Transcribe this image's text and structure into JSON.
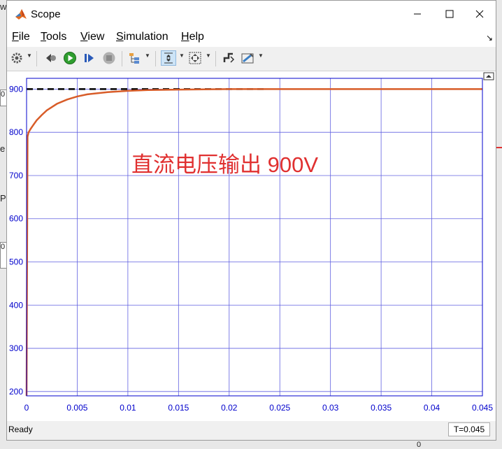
{
  "window": {
    "title": "Scope"
  },
  "menu": [
    {
      "label": "File",
      "key": "F",
      "rest": "ile"
    },
    {
      "label": "Tools",
      "key": "T",
      "rest": "ools"
    },
    {
      "label": "View",
      "key": "V",
      "rest": "iew"
    },
    {
      "label": "Simulation",
      "key": "S",
      "rest": "imulation"
    },
    {
      "label": "Help",
      "key": "H",
      "rest": "elp"
    }
  ],
  "toolbar": [
    "gear-icon",
    "step-back-icon",
    "run-icon",
    "step-forward-icon",
    "stop-icon",
    "signal-tree-icon",
    "zoom-icon",
    "fit-icon",
    "style-icon",
    "measure-icon"
  ],
  "annotation": "直流电压输出 900V",
  "status": {
    "text": "Ready",
    "time": "T=0.045"
  },
  "background_peeks": [
    "w",
    "0",
    "e",
    "PI",
    "0",
    "0"
  ],
  "colors": {
    "axes": "#0000cc",
    "grid": "#6060e0",
    "signal": "#d85c28",
    "reference": "#000000",
    "annotation": "#e03030"
  },
  "chart_data": {
    "type": "line",
    "xlim": [
      0,
      0.045
    ],
    "ylim": [
      190,
      925
    ],
    "xticks": [
      0,
      0.005,
      0.01,
      0.015,
      0.02,
      0.025,
      0.03,
      0.035,
      0.04,
      0.045
    ],
    "xtick_labels": [
      "0",
      "0.005",
      "0.01",
      "0.015",
      "0.02",
      "0.025",
      "0.03",
      "0.035",
      "0.04",
      "0.045"
    ],
    "yticks": [
      200,
      300,
      400,
      500,
      600,
      700,
      800,
      900
    ],
    "ytick_labels": [
      "200",
      "300",
      "400",
      "500",
      "600",
      "700",
      "800",
      "900"
    ],
    "grid": true,
    "series": [
      {
        "style": "dashed",
        "color": "#000000",
        "x": [
          0,
          0.0235
        ],
        "y": [
          900,
          900
        ]
      },
      {
        "style": "solid",
        "color": "#d85c28",
        "x": [
          0,
          0.0001,
          0.0002,
          0.0004,
          0.0007,
          0.001,
          0.0015,
          0.002,
          0.003,
          0.004,
          0.005,
          0.006,
          0.008,
          0.01,
          0.012,
          0.015,
          0.02,
          0.025,
          0.03,
          0.035,
          0.04,
          0.045
        ],
        "y": [
          190,
          790,
          800,
          808,
          818,
          828,
          840,
          851,
          866,
          876,
          883,
          888,
          893,
          896,
          898,
          899,
          900,
          900,
          900,
          900,
          900,
          900
        ]
      }
    ]
  }
}
